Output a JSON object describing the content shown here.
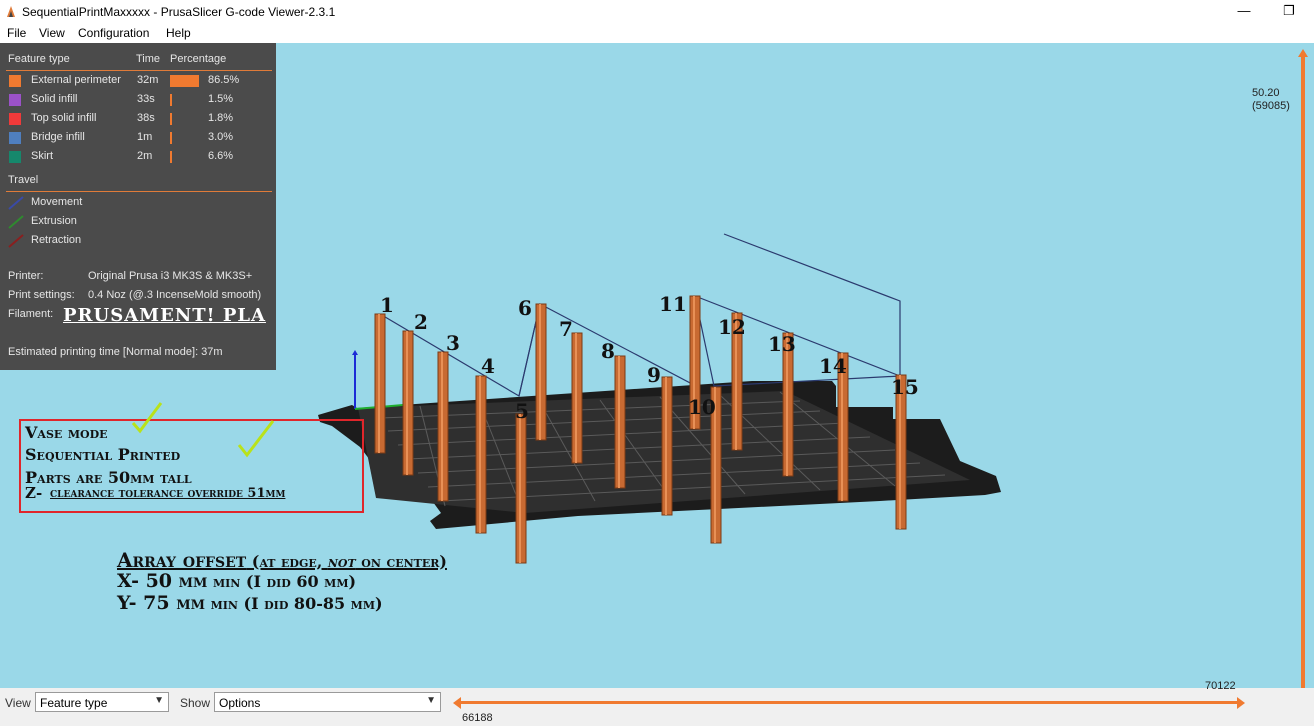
{
  "window": {
    "title": "SequentialPrintMaxxxxx - PrusaSlicer G-code Viewer-2.3.1",
    "minimize_glyph": "—",
    "restore_glyph": "❐"
  },
  "menu": [
    "File",
    "View",
    "Configuration",
    "Help"
  ],
  "legend": {
    "header": {
      "feature": "Feature type",
      "time": "Time",
      "percentage": "Percentage"
    },
    "features": [
      {
        "label": "External perimeter",
        "time": "32m",
        "percentage": "86.5%",
        "fraction": 0.865,
        "color": "#f07a30"
      },
      {
        "label": "Solid infill",
        "time": "33s",
        "percentage": "1.5%",
        "fraction": 0.015,
        "color": "#9b52c8"
      },
      {
        "label": "Top solid infill",
        "time": "38s",
        "percentage": "1.8%",
        "fraction": 0.018,
        "color": "#f03a3a"
      },
      {
        "label": "Bridge infill",
        "time": "1m",
        "percentage": "3.0%",
        "fraction": 0.03,
        "color": "#4f7fbf"
      },
      {
        "label": "Skirt",
        "time": "2m",
        "percentage": "6.6%",
        "fraction": 0.066,
        "color": "#16886c"
      }
    ],
    "travel_header": "Travel",
    "travel": [
      {
        "label": "Movement",
        "color": "#3a4aa6"
      },
      {
        "label": "Extrusion",
        "color": "#2f8a2f"
      },
      {
        "label": "Retraction",
        "color": "#8a1f1f"
      }
    ],
    "printer_label": "Printer:",
    "printer_value": "Original Prusa i3 MK3S & MK3S+",
    "print_settings_label": "Print settings:",
    "print_settings_value": "0.4 Noz (@.3 IncenseMold smooth)",
    "filament_label": "Filament:",
    "filament_value": "PRUSAMENT! PLA",
    "estimated_time": "Estimated printing time [Normal mode]:  37m"
  },
  "annotations": {
    "box_lines": [
      "Vase mode",
      "Sequential Printed",
      "Parts are 50mm tall"
    ],
    "z_prefix": "Z- ",
    "z_text": "clearance tolerance override 51mm",
    "array_title_a": "Array offset",
    "array_title_b": " (at edge, ",
    "array_title_not": "not",
    "array_title_c": " on center)",
    "x_line_a": "X- 50 mm",
    "x_line_b": " min (I did 60 mm)",
    "y_line_a": "Y- 75 mm",
    "y_line_b": " min (I did 80-85 mm)",
    "numbers": [
      "1",
      "2",
      "3",
      "4",
      "5",
      "6",
      "7",
      "8",
      "9",
      "10",
      "11",
      "12",
      "13",
      "14",
      "15"
    ]
  },
  "vertical_slider": {
    "top_value": "50.20",
    "top_move": "(59085)"
  },
  "bottom_bar": {
    "view_label": "View",
    "view_value": "Feature type",
    "show_label": "Show",
    "show_value": "Options",
    "slider_right_value": "70122",
    "slider_left_value": "66188"
  },
  "colors": {
    "viewport_bg": "#9ad8e8",
    "accent": "#f07a30",
    "annotation_box": "#e0262b",
    "check": "#b9e21a"
  }
}
